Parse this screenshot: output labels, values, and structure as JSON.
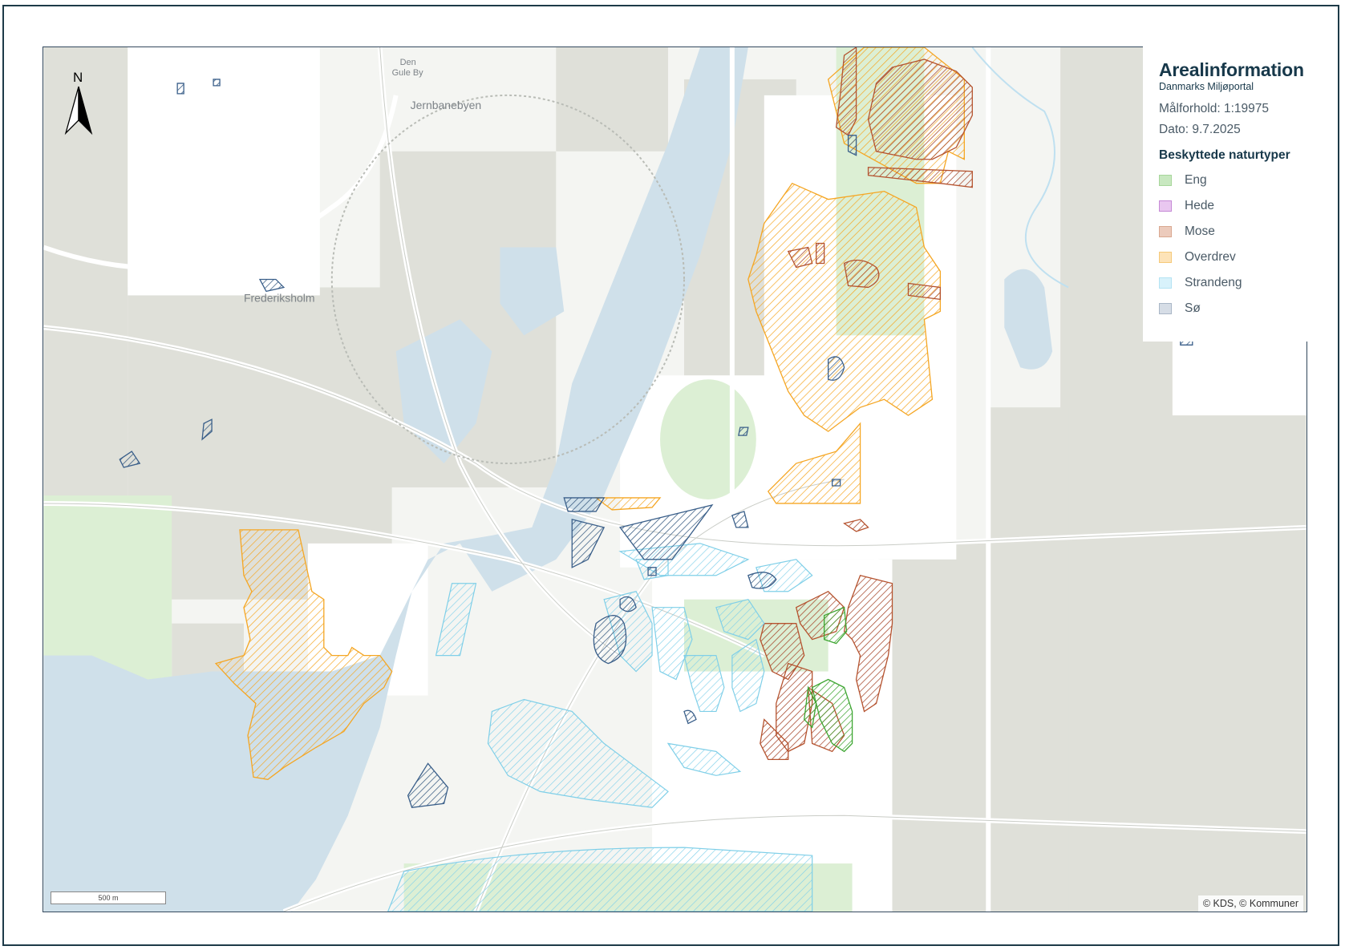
{
  "legend": {
    "title": "Arealinformation",
    "subtitle": "Danmarks Miljøportal",
    "scale_text": "Målforhold: 1:19975",
    "date_text": "Dato: 9.7.2025",
    "section_title": "Beskyttede naturtyper",
    "items": [
      {
        "label": "Eng",
        "color": "#c8e8c0",
        "border": "#a7d69b"
      },
      {
        "label": "Hede",
        "color": "#e9c7f0",
        "border": "#c68ad6"
      },
      {
        "label": "Mose",
        "color": "#eccbbc",
        "border": "#d9a890"
      },
      {
        "label": "Overdrev",
        "color": "#fde3b8",
        "border": "#f5c979"
      },
      {
        "label": "Strandeng",
        "color": "#d8f2fb",
        "border": "#b4e3f3"
      },
      {
        "label": "Sø",
        "color": "#d6dde6",
        "border": "#a9b6c6"
      }
    ]
  },
  "map": {
    "place_labels": {
      "den_gule_by_1": "Den",
      "den_gule_by_2": "Gule By",
      "jernbanebyen": "Jernbanebyen",
      "frederiksholm": "Frederiksholm"
    },
    "north_label": "N",
    "scalebar_label": "500 m",
    "copyright": "© KDS, © Kommuner",
    "layer_colors": {
      "water": "#cfe0ea",
      "land": "#f4f5f2",
      "buildings": "#dcddd6",
      "park": "#dcefd4",
      "overdrev": "#f5a623",
      "mose": "#b5532f",
      "so": "#3a5f8a",
      "strandeng": "#7fcfe8",
      "eng": "#4caf3c"
    }
  }
}
